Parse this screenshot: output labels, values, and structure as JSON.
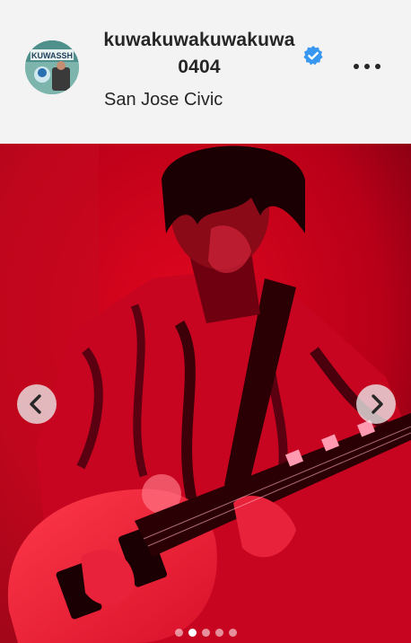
{
  "post": {
    "username": "kuwakuwakuwakuwa0404",
    "verified": true,
    "location": "San Jose Civic",
    "avatar_text": "KUWASSH"
  },
  "media": {
    "description_icon": "carousel-photo",
    "current_slide": 2,
    "total_slides": 5
  },
  "icons": {
    "verified": "verified-badge-icon",
    "more": "more-options-icon",
    "prev": "chevron-left-icon",
    "next": "chevron-right-icon"
  },
  "colors": {
    "verified_blue": "#3897f0",
    "text": "#262626",
    "header_bg": "#f3f3f3",
    "photo_red": "#d0001c"
  }
}
